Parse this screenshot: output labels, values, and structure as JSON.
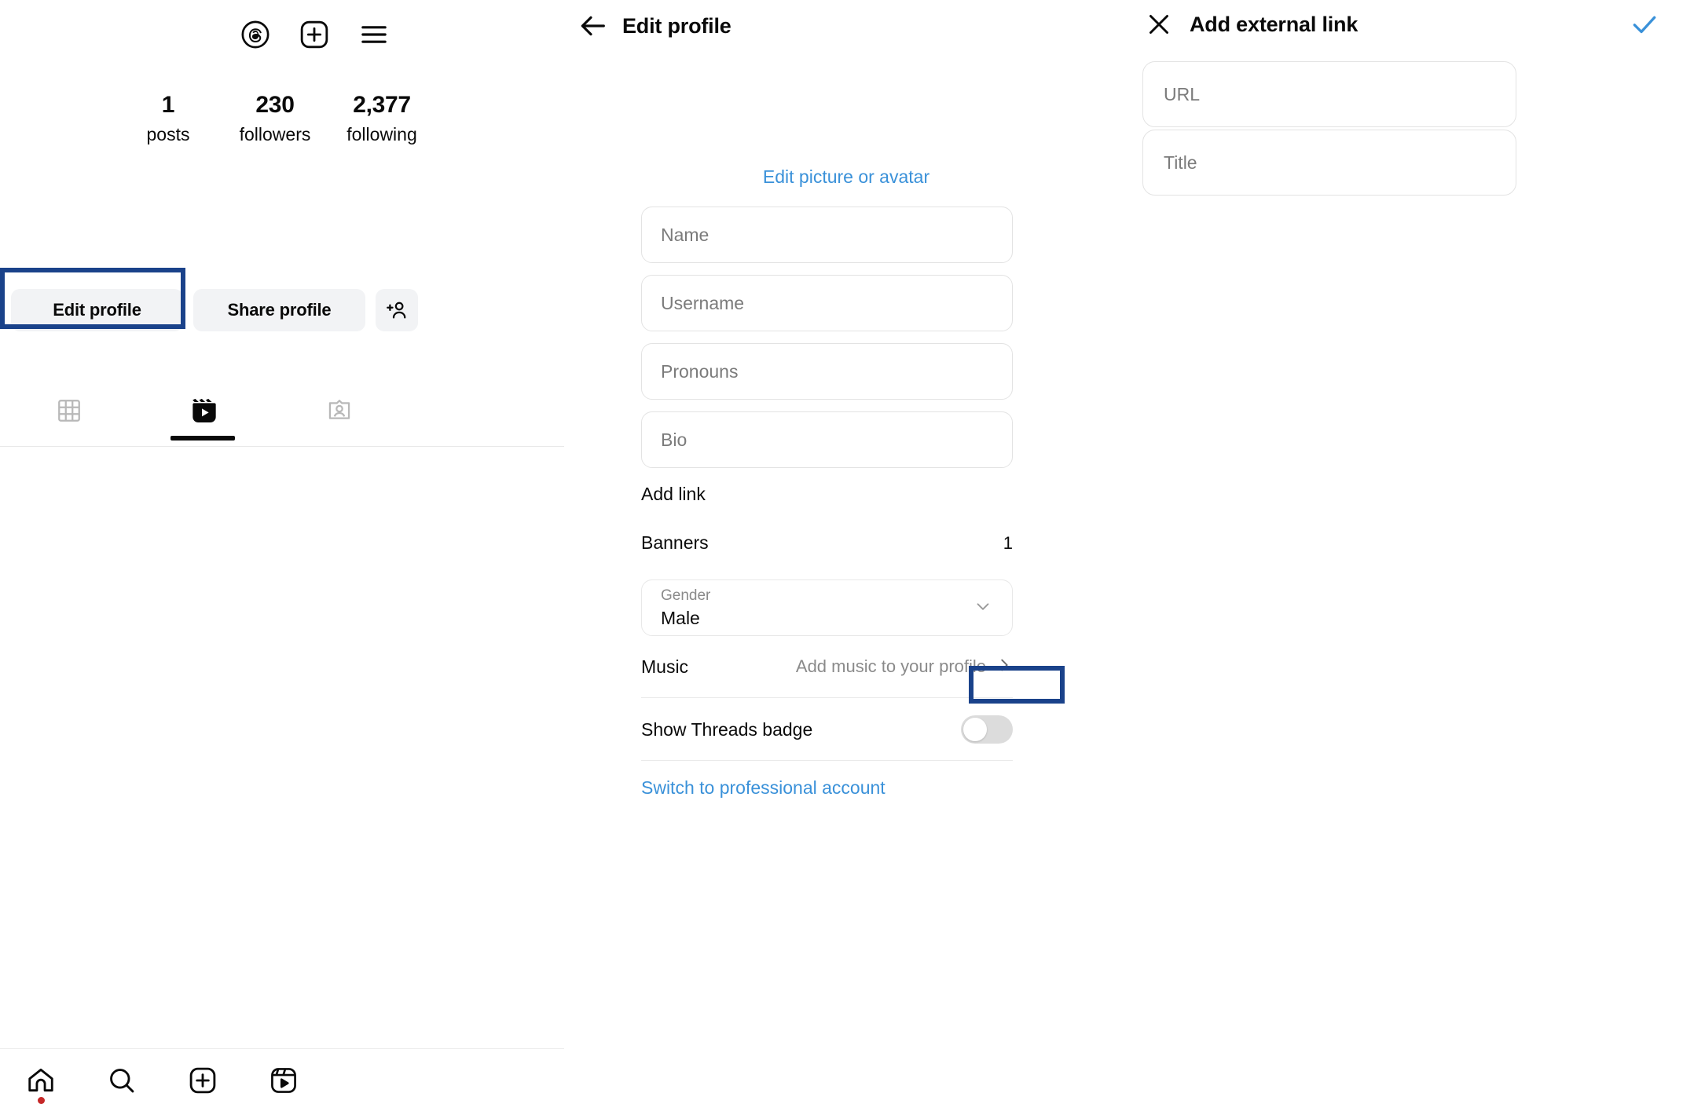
{
  "left_panel": {
    "topbar": {
      "threads_icon": "threads-icon",
      "new_post_icon": "plus-square-icon",
      "menu_icon": "hamburger-menu-icon"
    },
    "stats": [
      {
        "value": "1",
        "label": "posts"
      },
      {
        "value": "230",
        "label": "followers"
      },
      {
        "value": "2,377",
        "label": "following"
      }
    ],
    "actions": {
      "edit_profile_label": "Edit profile",
      "share_profile_label": "Share profile",
      "add_person_icon": "add-person-icon"
    },
    "tabs": [
      {
        "name": "grid",
        "icon": "grid-icon",
        "active": false
      },
      {
        "name": "reels",
        "icon": "reels-icon",
        "active": true
      },
      {
        "name": "tagged",
        "icon": "tagged-person-icon",
        "active": false
      }
    ],
    "bottom_nav": [
      {
        "name": "home",
        "icon": "home-icon",
        "badge_dot": true
      },
      {
        "name": "search",
        "icon": "search-icon",
        "badge_dot": false
      },
      {
        "name": "create",
        "icon": "plus-square-icon",
        "badge_dot": false
      },
      {
        "name": "reels",
        "icon": "reels-icon",
        "badge_dot": false
      }
    ]
  },
  "middle_panel": {
    "back_icon": "back-arrow-icon",
    "title": "Edit profile",
    "edit_picture_label": "Edit picture or avatar",
    "fields": [
      {
        "name": "name",
        "placeholder": "Name",
        "value": ""
      },
      {
        "name": "username",
        "placeholder": "Username",
        "value": ""
      },
      {
        "name": "pronouns",
        "placeholder": "Pronouns",
        "value": ""
      },
      {
        "name": "bio",
        "placeholder": "Bio",
        "value": ""
      }
    ],
    "add_link_label": "Add link",
    "banners_label": "Banners",
    "banners_count": "1",
    "gender": {
      "label": "Gender",
      "value": "Male",
      "chevron_icon": "chevron-down-icon"
    },
    "music": {
      "label": "Music",
      "value": "Add music to your profile",
      "chevron_icon": "chevron-right-icon"
    },
    "threads_badge": {
      "label": "Show Threads badge",
      "enabled": false
    },
    "switch_pro_label": "Switch to professional account"
  },
  "right_panel": {
    "close_icon": "close-x-icon",
    "title": "Add external link",
    "confirm_icon": "checkmark-icon",
    "fields": [
      {
        "name": "url",
        "placeholder": "URL",
        "value": ""
      },
      {
        "name": "title",
        "placeholder": "Title",
        "value": ""
      }
    ]
  },
  "annotations": {
    "highlight_color": "#1a428a",
    "boxes": [
      {
        "target": "edit-profile-button"
      },
      {
        "target": "add-link-label"
      }
    ]
  },
  "colors": {
    "link_blue": "#3a91d9",
    "confirm_blue": "#3a91d9",
    "text_primary": "#0a0a0a",
    "text_muted": "#8a8a8a",
    "pill_bg": "#f2f3f5",
    "notification_red": "#c62828"
  }
}
